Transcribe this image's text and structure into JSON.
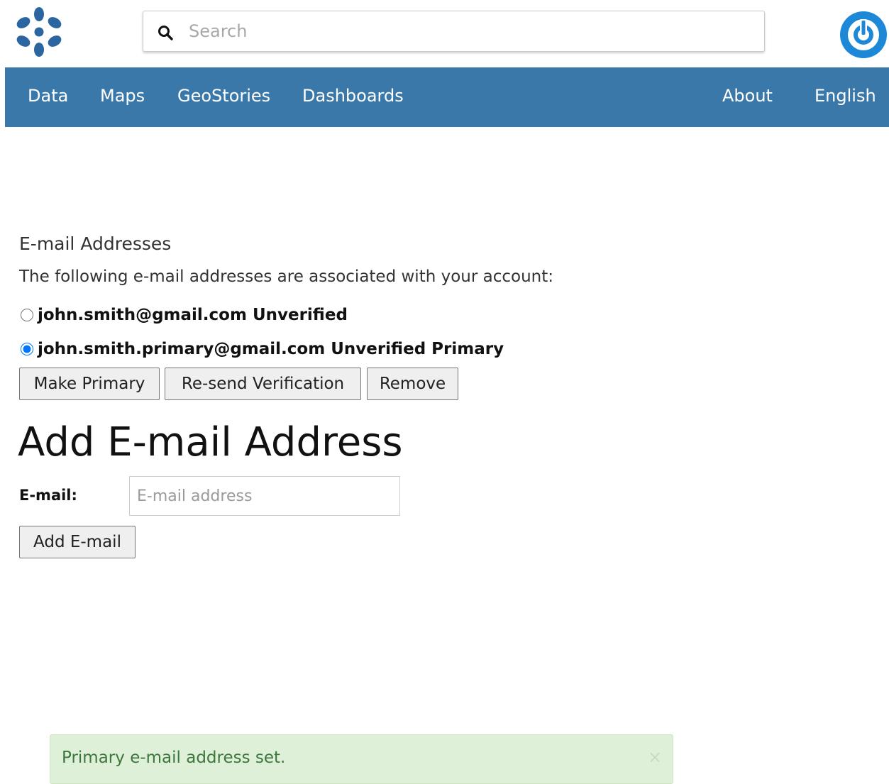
{
  "header": {
    "logo_icon": "geonode-logo-icon",
    "search_placeholder": "Search",
    "avatar_icon": "user-power-icon",
    "brand_color": "#1e88d8"
  },
  "nav": {
    "color": "#3a78aa",
    "items": [
      {
        "label": "Data"
      },
      {
        "label": "Maps"
      },
      {
        "label": "GeoStories"
      },
      {
        "label": "Dashboards"
      }
    ],
    "right_items": [
      {
        "label": "About"
      },
      {
        "label": "English"
      }
    ]
  },
  "emails": {
    "title": "E-mail Addresses",
    "description": "The following e-mail addresses are associated with your account:",
    "list": [
      {
        "text": "john.smith@gmail.com Unverified",
        "selected": false
      },
      {
        "text": "john.smith.primary@gmail.com Unverified Primary",
        "selected": true
      }
    ],
    "actions": {
      "make_primary": "Make Primary",
      "resend": "Re-send Verification",
      "remove": "Remove"
    }
  },
  "add_email": {
    "title": "Add E-mail Address",
    "label": "E-mail:",
    "placeholder": "E-mail address",
    "value": "",
    "button": "Add E-mail"
  },
  "alert": {
    "message": "Primary e-mail address set.",
    "close": "×"
  }
}
